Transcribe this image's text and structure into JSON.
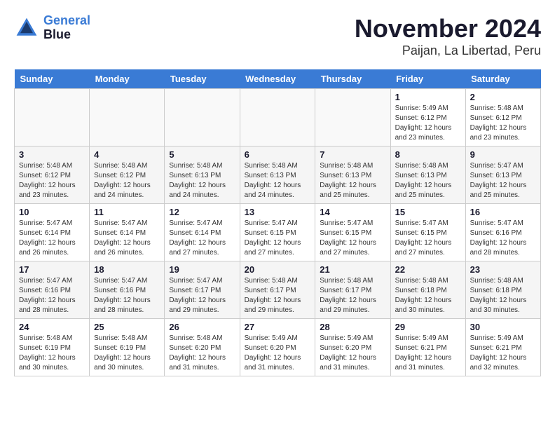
{
  "header": {
    "logo_line1": "General",
    "logo_line2": "Blue",
    "month_title": "November 2024",
    "location": "Paijan, La Libertad, Peru"
  },
  "weekdays": [
    "Sunday",
    "Monday",
    "Tuesday",
    "Wednesday",
    "Thursday",
    "Friday",
    "Saturday"
  ],
  "weeks": [
    [
      {
        "day": "",
        "sunrise": "",
        "sunset": "",
        "daylight": ""
      },
      {
        "day": "",
        "sunrise": "",
        "sunset": "",
        "daylight": ""
      },
      {
        "day": "",
        "sunrise": "",
        "sunset": "",
        "daylight": ""
      },
      {
        "day": "",
        "sunrise": "",
        "sunset": "",
        "daylight": ""
      },
      {
        "day": "",
        "sunrise": "",
        "sunset": "",
        "daylight": ""
      },
      {
        "day": "1",
        "sunrise": "Sunrise: 5:49 AM",
        "sunset": "Sunset: 6:12 PM",
        "daylight": "Daylight: 12 hours and 23 minutes."
      },
      {
        "day": "2",
        "sunrise": "Sunrise: 5:48 AM",
        "sunset": "Sunset: 6:12 PM",
        "daylight": "Daylight: 12 hours and 23 minutes."
      }
    ],
    [
      {
        "day": "3",
        "sunrise": "Sunrise: 5:48 AM",
        "sunset": "Sunset: 6:12 PM",
        "daylight": "Daylight: 12 hours and 23 minutes."
      },
      {
        "day": "4",
        "sunrise": "Sunrise: 5:48 AM",
        "sunset": "Sunset: 6:12 PM",
        "daylight": "Daylight: 12 hours and 24 minutes."
      },
      {
        "day": "5",
        "sunrise": "Sunrise: 5:48 AM",
        "sunset": "Sunset: 6:13 PM",
        "daylight": "Daylight: 12 hours and 24 minutes."
      },
      {
        "day": "6",
        "sunrise": "Sunrise: 5:48 AM",
        "sunset": "Sunset: 6:13 PM",
        "daylight": "Daylight: 12 hours and 24 minutes."
      },
      {
        "day": "7",
        "sunrise": "Sunrise: 5:48 AM",
        "sunset": "Sunset: 6:13 PM",
        "daylight": "Daylight: 12 hours and 25 minutes."
      },
      {
        "day": "8",
        "sunrise": "Sunrise: 5:48 AM",
        "sunset": "Sunset: 6:13 PM",
        "daylight": "Daylight: 12 hours and 25 minutes."
      },
      {
        "day": "9",
        "sunrise": "Sunrise: 5:47 AM",
        "sunset": "Sunset: 6:13 PM",
        "daylight": "Daylight: 12 hours and 25 minutes."
      }
    ],
    [
      {
        "day": "10",
        "sunrise": "Sunrise: 5:47 AM",
        "sunset": "Sunset: 6:14 PM",
        "daylight": "Daylight: 12 hours and 26 minutes."
      },
      {
        "day": "11",
        "sunrise": "Sunrise: 5:47 AM",
        "sunset": "Sunset: 6:14 PM",
        "daylight": "Daylight: 12 hours and 26 minutes."
      },
      {
        "day": "12",
        "sunrise": "Sunrise: 5:47 AM",
        "sunset": "Sunset: 6:14 PM",
        "daylight": "Daylight: 12 hours and 27 minutes."
      },
      {
        "day": "13",
        "sunrise": "Sunrise: 5:47 AM",
        "sunset": "Sunset: 6:15 PM",
        "daylight": "Daylight: 12 hours and 27 minutes."
      },
      {
        "day": "14",
        "sunrise": "Sunrise: 5:47 AM",
        "sunset": "Sunset: 6:15 PM",
        "daylight": "Daylight: 12 hours and 27 minutes."
      },
      {
        "day": "15",
        "sunrise": "Sunrise: 5:47 AM",
        "sunset": "Sunset: 6:15 PM",
        "daylight": "Daylight: 12 hours and 27 minutes."
      },
      {
        "day": "16",
        "sunrise": "Sunrise: 5:47 AM",
        "sunset": "Sunset: 6:16 PM",
        "daylight": "Daylight: 12 hours and 28 minutes."
      }
    ],
    [
      {
        "day": "17",
        "sunrise": "Sunrise: 5:47 AM",
        "sunset": "Sunset: 6:16 PM",
        "daylight": "Daylight: 12 hours and 28 minutes."
      },
      {
        "day": "18",
        "sunrise": "Sunrise: 5:47 AM",
        "sunset": "Sunset: 6:16 PM",
        "daylight": "Daylight: 12 hours and 28 minutes."
      },
      {
        "day": "19",
        "sunrise": "Sunrise: 5:47 AM",
        "sunset": "Sunset: 6:17 PM",
        "daylight": "Daylight: 12 hours and 29 minutes."
      },
      {
        "day": "20",
        "sunrise": "Sunrise: 5:48 AM",
        "sunset": "Sunset: 6:17 PM",
        "daylight": "Daylight: 12 hours and 29 minutes."
      },
      {
        "day": "21",
        "sunrise": "Sunrise: 5:48 AM",
        "sunset": "Sunset: 6:17 PM",
        "daylight": "Daylight: 12 hours and 29 minutes."
      },
      {
        "day": "22",
        "sunrise": "Sunrise: 5:48 AM",
        "sunset": "Sunset: 6:18 PM",
        "daylight": "Daylight: 12 hours and 30 minutes."
      },
      {
        "day": "23",
        "sunrise": "Sunrise: 5:48 AM",
        "sunset": "Sunset: 6:18 PM",
        "daylight": "Daylight: 12 hours and 30 minutes."
      }
    ],
    [
      {
        "day": "24",
        "sunrise": "Sunrise: 5:48 AM",
        "sunset": "Sunset: 6:19 PM",
        "daylight": "Daylight: 12 hours and 30 minutes."
      },
      {
        "day": "25",
        "sunrise": "Sunrise: 5:48 AM",
        "sunset": "Sunset: 6:19 PM",
        "daylight": "Daylight: 12 hours and 30 minutes."
      },
      {
        "day": "26",
        "sunrise": "Sunrise: 5:48 AM",
        "sunset": "Sunset: 6:20 PM",
        "daylight": "Daylight: 12 hours and 31 minutes."
      },
      {
        "day": "27",
        "sunrise": "Sunrise: 5:49 AM",
        "sunset": "Sunset: 6:20 PM",
        "daylight": "Daylight: 12 hours and 31 minutes."
      },
      {
        "day": "28",
        "sunrise": "Sunrise: 5:49 AM",
        "sunset": "Sunset: 6:20 PM",
        "daylight": "Daylight: 12 hours and 31 minutes."
      },
      {
        "day": "29",
        "sunrise": "Sunrise: 5:49 AM",
        "sunset": "Sunset: 6:21 PM",
        "daylight": "Daylight: 12 hours and 31 minutes."
      },
      {
        "day": "30",
        "sunrise": "Sunrise: 5:49 AM",
        "sunset": "Sunset: 6:21 PM",
        "daylight": "Daylight: 12 hours and 32 minutes."
      }
    ]
  ]
}
